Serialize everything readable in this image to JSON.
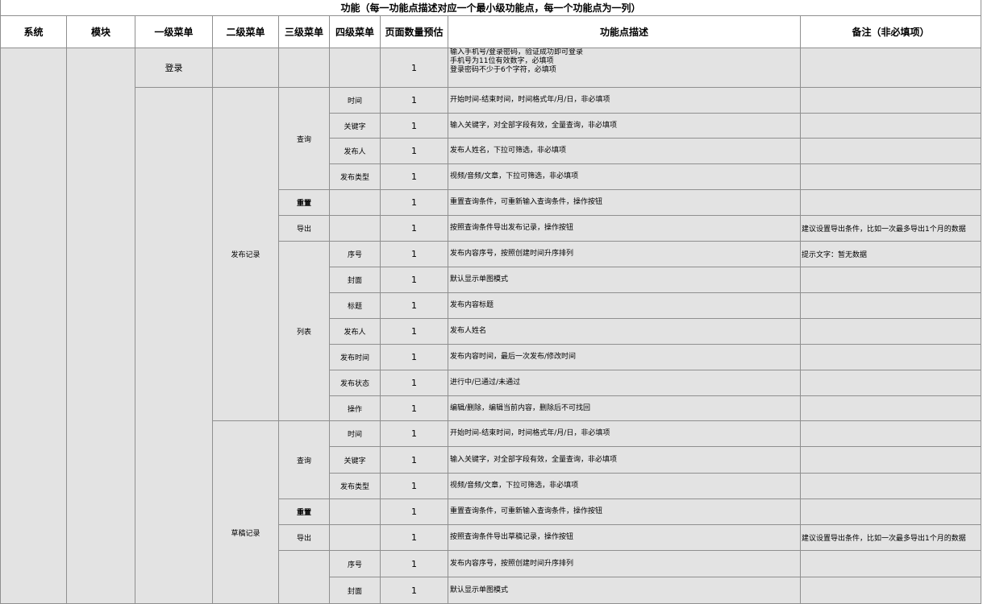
{
  "sheet_title": "功能（每一功能点描述对应一个最小级功能点，每一个功能点为一列）",
  "headers": {
    "system": "系统",
    "module": "模块",
    "menu1": "一级菜单",
    "menu2": "二级菜单",
    "menu3": "三级菜单",
    "menu4": "四级菜单",
    "pages": "页面数量预估",
    "desc": "功能点描述",
    "note": "备注（非必填项）"
  },
  "menu1": {
    "login": "登录"
  },
  "menu2": {
    "publish_record": "发布记录",
    "draft_record": "草稿记录"
  },
  "menu3": {
    "query": "查询",
    "reset": "重置",
    "export": "导出",
    "list": "列表"
  },
  "menu4": {
    "time": "时间",
    "keyword": "关键字",
    "publisher": "发布人",
    "publish_type": "发布类型",
    "seq": "序号",
    "cover": "封面",
    "title": "标题",
    "publish_time": "发布时间",
    "publish_status": "发布状态",
    "action": "操作"
  },
  "count": "1",
  "desc": {
    "login_1": "输入手机号/登录密码，验证成功即可登录",
    "login_2": "手机号为11位有效数字，必填项",
    "login_3": "登录密码不少于6个字符，必填项",
    "time": "开始时间-结束时间，时间格式年/月/日，非必填项",
    "keyword": "输入关键字，对全部字段有效，全量查询，非必填项",
    "publisher": "发布人姓名，下拉可筛选，非必填项",
    "publish_type": "视频/音频/文章，下拉可筛选，非必填项",
    "reset": "重置查询条件，可重新输入查询条件，操作按钮",
    "export_publish": "按照查询条件导出发布记录，操作按钮",
    "seq": "发布内容序号，按照创建时间升序排列",
    "cover": "默认显示单图模式",
    "title": "发布内容标题",
    "publisher_name": "发布人姓名",
    "publish_time": "发布内容时间，最后一次发布/修改时间",
    "publish_status": "进行中/已通过/未通过",
    "action": "编辑/删除，编辑当前内容，删除后不可找回",
    "export_draft": "按照查询条件导出草稿记录，操作按钮"
  },
  "notes": {
    "export": "建议设置导出条件，比如一次最多导出1个月的数据",
    "empty": "提示文字：暂无数据"
  }
}
